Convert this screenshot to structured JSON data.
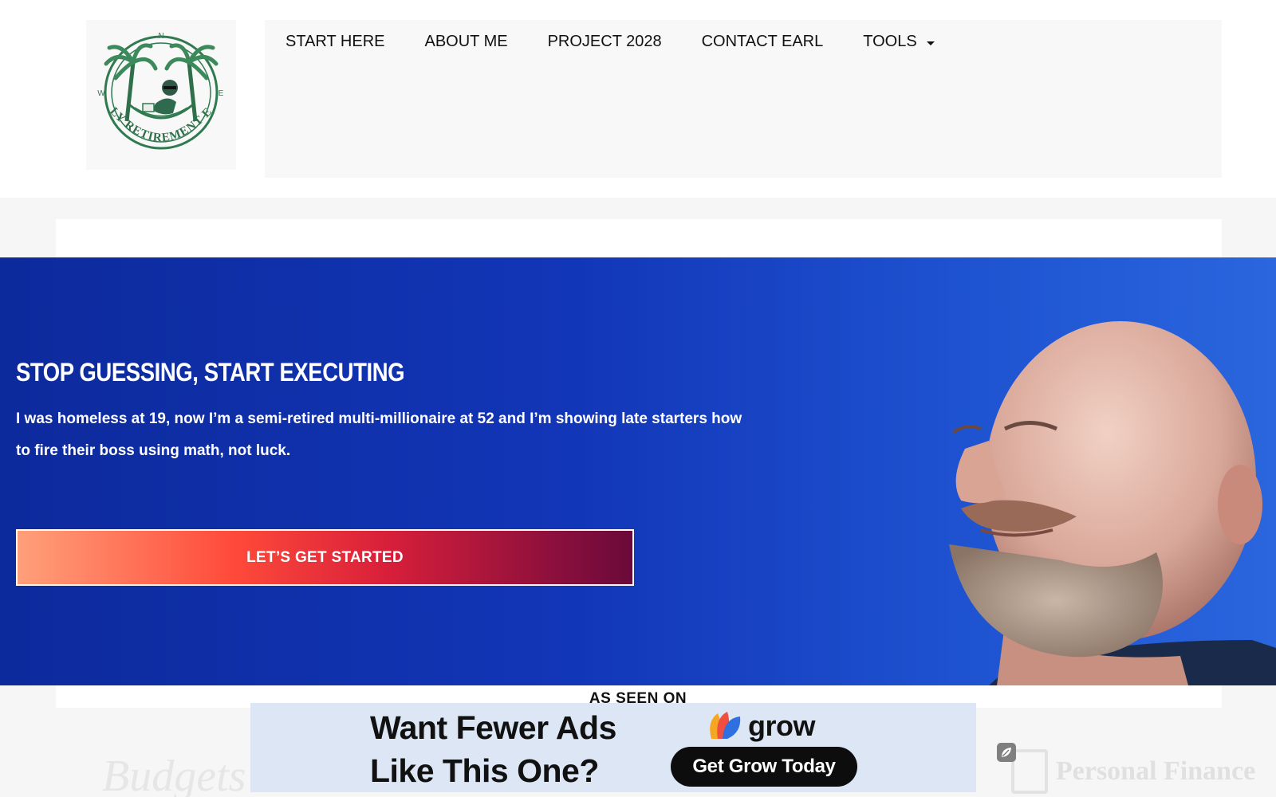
{
  "header": {
    "logo": {
      "alt": "Early Retirement Earl logo",
      "wordmark": "EARLY RETIREMENT EARL",
      "icon": "palm-tree-hammock-icon"
    },
    "nav": [
      {
        "label": "START HERE"
      },
      {
        "label": "ABOUT ME"
      },
      {
        "label": "PROJECT 2028"
      },
      {
        "label": "CONTACT EARL"
      },
      {
        "label": "TOOLS",
        "has_dropdown": true
      }
    ]
  },
  "hero": {
    "title": "STOP GUESSING, START EXECUTING",
    "subtitle": "I was homeless at 19, now I’m a semi-retired multi-millionaire at 52 and I’m showing late starters how to fire their boss using math, not luck.",
    "cta_label": "LET’S GET STARTED",
    "portrait": "man-looking-up-photo",
    "colors": {
      "background_start": "#0d2a9c",
      "background_end": "#2a66de",
      "cta_gradient": [
        "#ffa07a",
        "#ff4a3a",
        "#d81f3a",
        "#6a0a3a"
      ]
    }
  },
  "as_seen_on": {
    "heading": "AS SEEN ON",
    "logos": [
      "Budgets",
      "Personal Finance"
    ]
  },
  "ad": {
    "headline_line1": "Want Fewer Ads",
    "headline_line2": "Like This One?",
    "brand": "grow",
    "brand_icon": "grow-leaf-icon",
    "cta_label": "Get Grow Today",
    "side_icon": "leaf-icon",
    "background": "#dce6f5"
  }
}
